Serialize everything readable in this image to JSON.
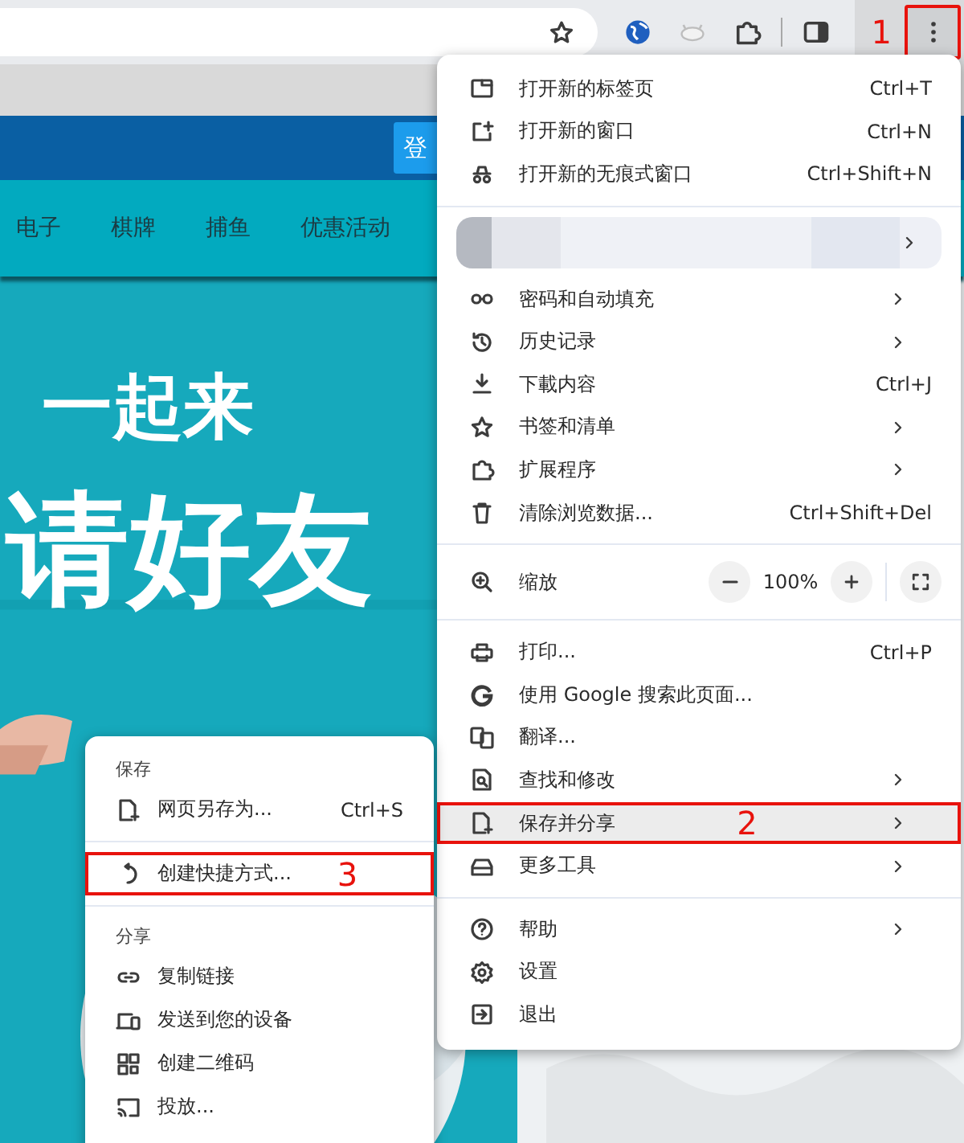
{
  "toolbar": {
    "menu_button": {
      "annotation": "1"
    }
  },
  "page": {
    "login_button": "登",
    "nav": [
      "电子",
      "棋牌",
      "捕鱼",
      "优惠活动"
    ],
    "headline": [
      "一起来",
      "请好友"
    ]
  },
  "menu": {
    "items": [
      {
        "kind": "item",
        "label": "打开新的标签页",
        "shortcut": "Ctrl+T",
        "submenu": false,
        "selected": false
      },
      {
        "kind": "item",
        "label": "打开新的窗口",
        "shortcut": "Ctrl+N",
        "submenu": false,
        "selected": false
      },
      {
        "kind": "item",
        "label": "打开新的无痕式窗口",
        "shortcut": "Ctrl+Shift+N",
        "submenu": false,
        "selected": false
      },
      {
        "kind": "divider"
      },
      {
        "kind": "profile",
        "submenu": true
      },
      {
        "kind": "item",
        "label": "密码和自动填充",
        "submenu": true,
        "selected": false
      },
      {
        "kind": "item",
        "label": "历史记录",
        "submenu": true,
        "selected": false
      },
      {
        "kind": "item",
        "label": "下載内容",
        "shortcut": "Ctrl+J",
        "submenu": false,
        "selected": false
      },
      {
        "kind": "item",
        "label": "书签和清单",
        "submenu": true,
        "selected": false
      },
      {
        "kind": "item",
        "label": "扩展程序",
        "submenu": true,
        "selected": false
      },
      {
        "kind": "item",
        "label": "清除浏览数据...",
        "shortcut": "Ctrl+Shift+Del",
        "submenu": false,
        "selected": false
      },
      {
        "kind": "divider"
      },
      {
        "kind": "zoom",
        "label": "缩放",
        "value": "100%"
      },
      {
        "kind": "divider"
      },
      {
        "kind": "item",
        "label": "打印...",
        "shortcut": "Ctrl+P",
        "submenu": false,
        "selected": false
      },
      {
        "kind": "item",
        "label": "使用 Google 搜索此页面...",
        "submenu": false,
        "selected": false
      },
      {
        "kind": "item",
        "label": "翻译...",
        "submenu": false,
        "selected": false
      },
      {
        "kind": "item",
        "label": "查找和修改",
        "submenu": true,
        "selected": false
      },
      {
        "kind": "item",
        "label": "保存并分享",
        "submenu": true,
        "selected": true,
        "annotation": "2"
      },
      {
        "kind": "item",
        "label": "更多工具",
        "submenu": true,
        "selected": false
      },
      {
        "kind": "divider"
      },
      {
        "kind": "item",
        "label": "帮助",
        "submenu": true,
        "selected": false
      },
      {
        "kind": "item",
        "label": "设置",
        "submenu": false,
        "selected": false
      },
      {
        "kind": "item",
        "label": "退出",
        "submenu": false,
        "selected": false
      }
    ]
  },
  "submenu": {
    "items": [
      {
        "kind": "header",
        "label": "保存"
      },
      {
        "kind": "item",
        "label": "网页另存为...",
        "shortcut": "Ctrl+S",
        "selected": false
      },
      {
        "kind": "divider"
      },
      {
        "kind": "item",
        "label": "创建快捷方式...",
        "selected": false,
        "annotation": "3"
      },
      {
        "kind": "divider"
      },
      {
        "kind": "header",
        "label": "分享"
      },
      {
        "kind": "item",
        "label": "复制链接",
        "selected": false
      },
      {
        "kind": "item",
        "label": "发送到您的设备",
        "selected": false
      },
      {
        "kind": "item",
        "label": "创建二维码",
        "selected": false
      },
      {
        "kind": "item",
        "label": "投放...",
        "selected": false
      }
    ]
  }
}
